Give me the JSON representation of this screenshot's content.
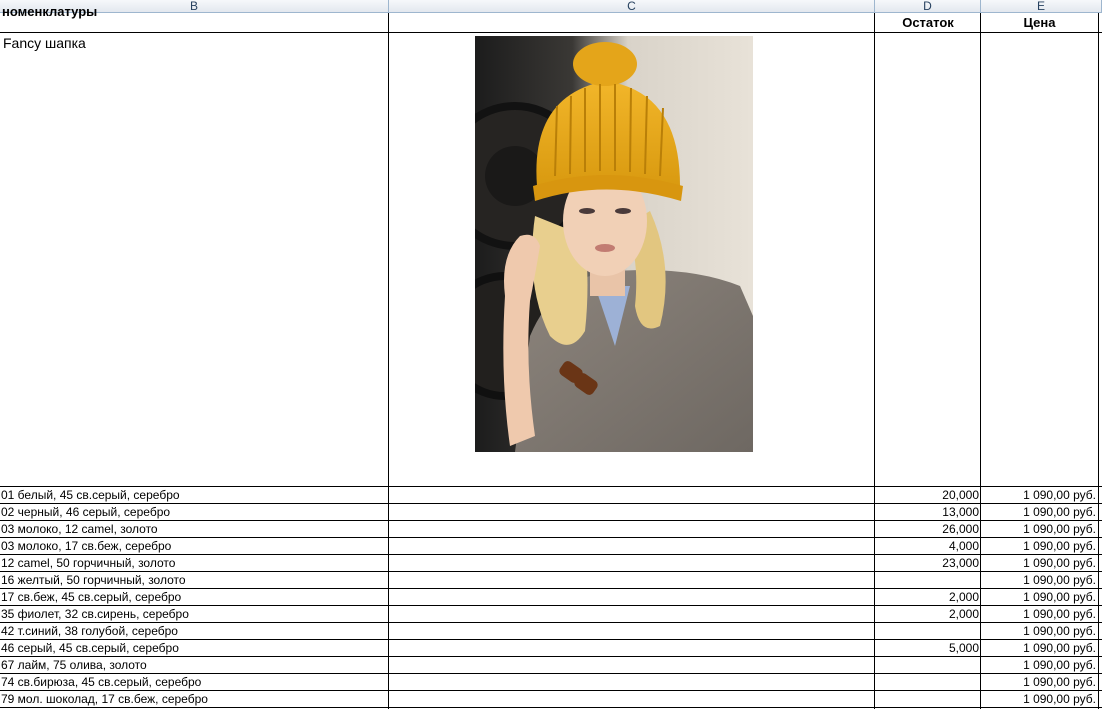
{
  "columns": {
    "b": "B",
    "c": "C",
    "d": "D",
    "e": "E"
  },
  "header": {
    "name_col": "номенклатуры",
    "stock_col": "Остаток",
    "price_col": "Цена"
  },
  "product": {
    "title": "Fancy шапка"
  },
  "rows": [
    {
      "name": "01 белый, 45 св.серый, серебро",
      "stock": "20,000",
      "price": "1 090,00 руб."
    },
    {
      "name": "02 черный, 46 серый, серебро",
      "stock": "13,000",
      "price": "1 090,00 руб."
    },
    {
      "name": "03 молоко, 12 camel, золото",
      "stock": "26,000",
      "price": "1 090,00 руб."
    },
    {
      "name": "03 молоко, 17 св.беж, серебро",
      "stock": "4,000",
      "price": "1 090,00 руб."
    },
    {
      "name": "12 camel, 50 горчичный, золото",
      "stock": "23,000",
      "price": "1 090,00 руб."
    },
    {
      "name": "16 желтый, 50 горчичный, золото",
      "stock": "",
      "price": "1 090,00 руб."
    },
    {
      "name": "17 св.беж, 45 св.серый, серебро",
      "stock": "2,000",
      "price": "1 090,00 руб."
    },
    {
      "name": "35 фиолет, 32 св.сирень, серебро",
      "stock": "2,000",
      "price": "1 090,00 руб."
    },
    {
      "name": "42 т.синий, 38 голубой, серебро",
      "stock": "",
      "price": "1 090,00 руб."
    },
    {
      "name": "46 серый, 45 св.серый, серебро",
      "stock": "5,000",
      "price": "1 090,00 руб."
    },
    {
      "name": "67 лайм, 75 олива, золото",
      "stock": "",
      "price": "1 090,00 руб."
    },
    {
      "name": "74 св.бирюза, 45 св.серый, серебро",
      "stock": "",
      "price": "1 090,00 руб."
    },
    {
      "name": "79 мол. шоколад, 17 св.беж, серебро",
      "stock": "",
      "price": "1 090,00 руб."
    }
  ],
  "colors": {
    "header_text": "#27415f",
    "grid": "#000000",
    "hat": "#e8a818"
  }
}
